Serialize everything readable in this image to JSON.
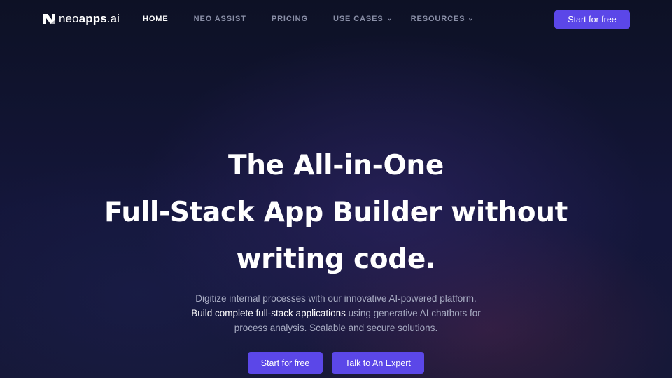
{
  "brand": {
    "logo_light": "neo",
    "logo_bold": "apps",
    "logo_suffix": ".ai",
    "accent_color": "#5b47e8"
  },
  "nav": {
    "items": [
      {
        "label": "HOME",
        "active": true,
        "has_dropdown": false
      },
      {
        "label": "NEO ASSIST",
        "active": false,
        "has_dropdown": false
      },
      {
        "label": "PRICING",
        "active": false,
        "has_dropdown": false
      },
      {
        "label": "USE CASES",
        "active": false,
        "has_dropdown": true
      },
      {
        "label": "RESOURCES",
        "active": false,
        "has_dropdown": true
      }
    ],
    "cta_label": "Start for free"
  },
  "hero": {
    "title_lines": [
      "The All-in-One",
      "Full-Stack App Builder without",
      "writing code."
    ],
    "subtitle": {
      "line1": "Digitize internal processes with our innovative AI-powered platform.",
      "line2_highlight": "Build complete full-stack applications",
      "line2_rest": " using generative AI chatbots for",
      "line3": "process analysis. Scalable and secure solutions."
    },
    "primary_button": "Start for free",
    "secondary_button": "Talk to An Expert"
  },
  "icons": {
    "logo": "neoapps-logo-icon",
    "dropdown": "chevron-down-icon"
  }
}
